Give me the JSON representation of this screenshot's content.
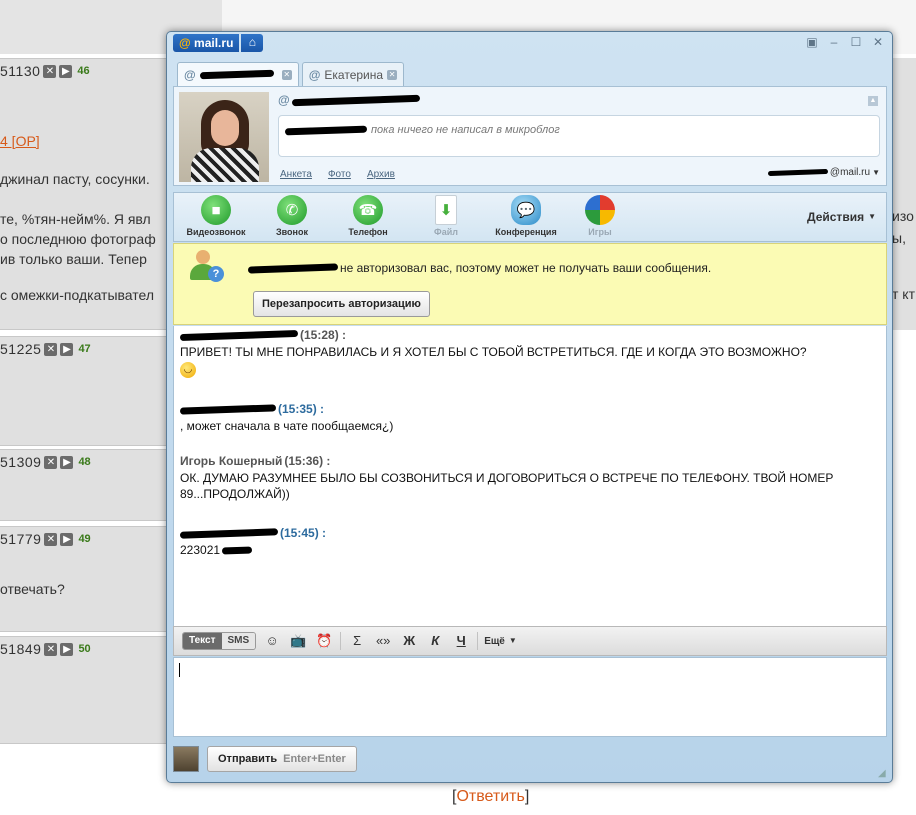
{
  "background": {
    "posts": [
      {
        "number": "51130",
        "count": "46"
      },
      {
        "number": "51225",
        "count": "47"
      },
      {
        "number": "51309",
        "count": "48"
      },
      {
        "number": "51779",
        "count": "49"
      },
      {
        "number": "51849",
        "count": "50"
      }
    ],
    "fragments": {
      "op_link": "4 [OP]",
      "line1": "джинал пасту, сосунки.",
      "line2": "те, %тян-нейм%. Я явл",
      "line3": "о последнюю фотограф",
      "line4": "ив только ваши. Тепер",
      "line5": "с омежки-подкатывател",
      "line6": "отвечать?",
      "right1": "изо",
      "right2": "ы,",
      "right3": "т кт"
    },
    "reply": {
      "open": "[",
      "link": "Ответить",
      "close": "]"
    }
  },
  "window": {
    "brand": {
      "at": "@",
      "name": "mail.ru"
    },
    "tabs": [
      {
        "label": ""
      },
      {
        "label": "Екатерина"
      }
    ],
    "contact": {
      "microblog": "пока ничего не написал в микроблог",
      "links": [
        "Анкета",
        "Фото",
        "Архив"
      ],
      "email_suffix": "@mail.ru"
    },
    "toolbar": {
      "buttons": [
        {
          "label": "Видеозвонок",
          "icon": "video-icon"
        },
        {
          "label": "Звонок",
          "icon": "phone-icon"
        },
        {
          "label": "Телефон",
          "icon": "telephone-icon"
        },
        {
          "label": "Файл",
          "icon": "file-icon"
        },
        {
          "label": "Конференция",
          "icon": "conference-icon"
        },
        {
          "label": "Игры",
          "icon": "games-icon"
        }
      ],
      "actions_label": "Действия"
    },
    "auth": {
      "message": "не авторизовал вас, поэтому может не получать ваши сообщения.",
      "button": "Перезапросить авторизацию"
    },
    "messages": [
      {
        "time": "(15:28) :",
        "text": "ПРИВЕТ! ТЫ МНЕ ПОНРАВИЛАСЬ И Я ХОТЕЛ БЫ С ТОБОЙ ВСТРЕТИТЬСЯ. ГДЕ И КОГДА ЭТО ВОЗМОЖНО?"
      },
      {
        "time": "(15:35) :",
        "text": ", может сначала в чате пообщаемся¿)"
      },
      {
        "sender": "Игорь Кошерный",
        "time": "(15:36) :",
        "text": "ОК. ДУМАЮ РАЗУМНЕЕ БЫЛО БЫ СОЗВОНИТЬСЯ И ДОГОВОРИТЬСЯ О ВСТРЕЧЕ ПО ТЕЛЕФОНУ. ТВОЙ НОМЕР 89...ПРОДОЛЖАЙ))"
      },
      {
        "time": "(15:45) :",
        "text": "223021"
      }
    ],
    "format_bar": {
      "mode_text": "Текст",
      "mode_sms": "SMS",
      "bold": "Ж",
      "italic": "К",
      "underline": "Ч",
      "quote": "«»",
      "translit": "Σ",
      "more": "Ещё"
    },
    "send": {
      "label": "Отправить",
      "hint": "Enter+Enter"
    }
  }
}
